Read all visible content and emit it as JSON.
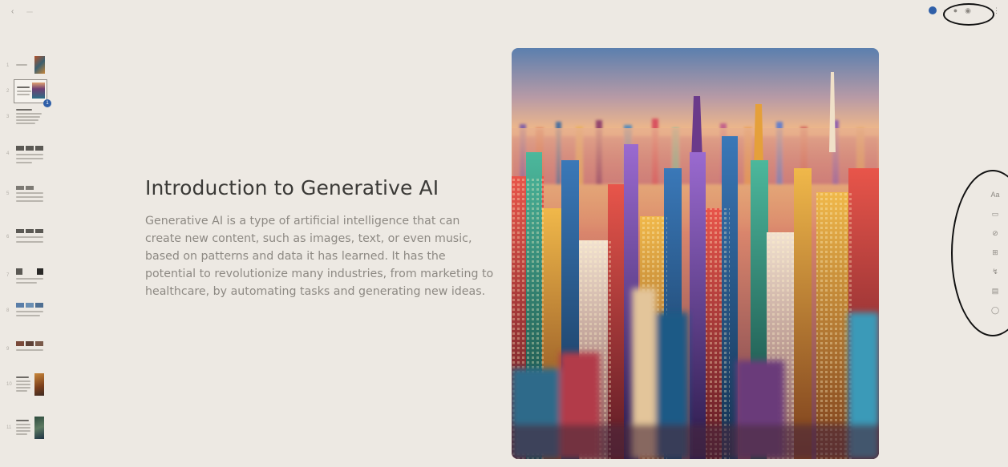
{
  "topbar": {
    "back_icon": "chevron-left-icon",
    "breadcrumb_text": "",
    "doc_chip": "",
    "right_buttons": [
      "",
      ""
    ]
  },
  "thumbnails": {
    "numbers": [
      "1",
      "2",
      "3",
      "4",
      "5",
      "6",
      "7",
      "8",
      "9",
      "10",
      "11"
    ],
    "active_index": 2,
    "badge": "1"
  },
  "slide": {
    "title": "Introduction to Generative AI",
    "body": "Generative AI is a type of artificial intelligence that can create new content, such as images, text, or even music, based on patterns and data it has learned. It has the potential to revolutionize many industries, from marketing to healthcare, by automating tasks and generating new ideas.",
    "image_icon": "city-skyline-image"
  },
  "right_tools": {
    "items": [
      "Aa",
      "▭",
      "⊘",
      "⊞",
      "↯",
      "▤",
      "◯"
    ]
  },
  "colors": {
    "background": "#ede9e3",
    "accent": "#2f5fa8",
    "title": "#3b3a37",
    "body": "#8d8983"
  }
}
